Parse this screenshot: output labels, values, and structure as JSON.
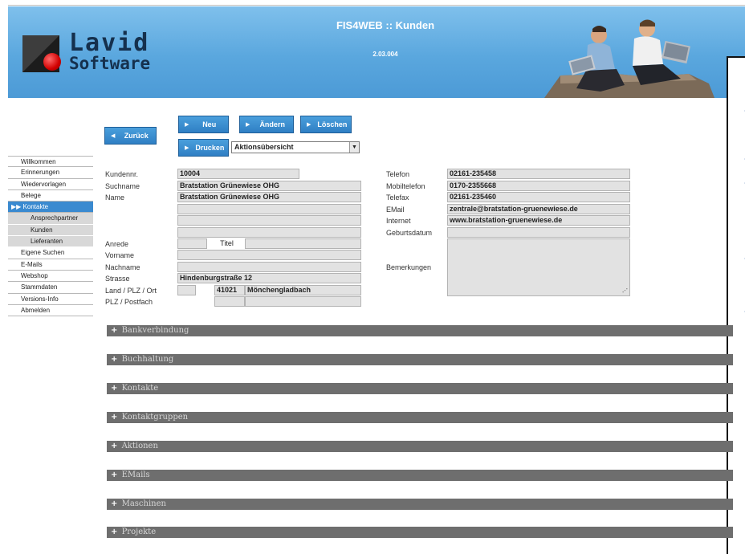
{
  "header": {
    "title": "FIS4WEB :: Kunden",
    "version": "2.03.004",
    "logo_line1": "Lavid",
    "logo_line2": "Software"
  },
  "toolbar": {
    "back": "Zurück",
    "new": "Neu",
    "edit": "Ändern",
    "delete": "Löschen",
    "print": "Drucken",
    "print_select": "Aktionsübersicht"
  },
  "sidebar": {
    "items": [
      {
        "label": "Willkommen"
      },
      {
        "label": "Erinnerungen"
      },
      {
        "label": "Wiedervorlagen"
      },
      {
        "label": "Belege"
      },
      {
        "label": "Kontakte"
      },
      {
        "label": "Ansprechpartner"
      },
      {
        "label": "Kunden"
      },
      {
        "label": "Lieferanten"
      },
      {
        "label": "Eigene Suchen"
      },
      {
        "label": "E-Mails"
      },
      {
        "label": "Webshop"
      },
      {
        "label": "Stammdaten"
      },
      {
        "label": "Versions-Info"
      },
      {
        "label": "Abmelden"
      }
    ]
  },
  "form": {
    "labels": {
      "customer_no": "Kundennr.",
      "search_name": "Suchname",
      "name": "Name",
      "salutation": "Anrede",
      "title": "Titel",
      "first_name": "Vorname",
      "last_name": "Nachname",
      "street": "Strasse",
      "country_zip_city": "Land / PLZ / Ort",
      "zip_pobox": "PLZ / Postfach",
      "phone": "Telefon",
      "mobile": "Mobiltelefon",
      "fax": "Telefax",
      "email": "EMail",
      "internet": "Internet",
      "birthday": "Geburtsdatum",
      "remarks": "Bemerkungen"
    },
    "values": {
      "customer_no": "10004",
      "search_name": "Bratstation Grünewiese OHG",
      "name": "Bratstation Grünewiese OHG",
      "street": "Hindenburgstraße 12",
      "zip": "41021",
      "city": "Mönchengladbach",
      "phone": "02161-235458",
      "mobile": "0170-2355668",
      "fax": "02161-235460",
      "email": "zentrale@bratstation-gruenewiese.de",
      "internet": "www.bratstation-gruenewiese.de"
    }
  },
  "sections": [
    {
      "label": "Bankverbindung"
    },
    {
      "label": "Buchhaltung"
    },
    {
      "label": "Kontakte"
    },
    {
      "label": "Kontaktgruppen"
    },
    {
      "label": "Aktionen"
    },
    {
      "label": "EMails"
    },
    {
      "label": "Maschinen"
    },
    {
      "label": "Projekte"
    }
  ],
  "icons": {
    "button_arrow": "triangle-right-icon",
    "back_arrow": "triangle-left-icon",
    "active_marker": "double-chevron-right-icon",
    "expand": "plus-icon",
    "dropdown": "triangle-down-icon"
  },
  "colors": {
    "header_blue": "#5aa7de",
    "button_blue": "#3a8ad0",
    "section_gray": "#6e6e6e",
    "logo_red": "#d10000"
  }
}
